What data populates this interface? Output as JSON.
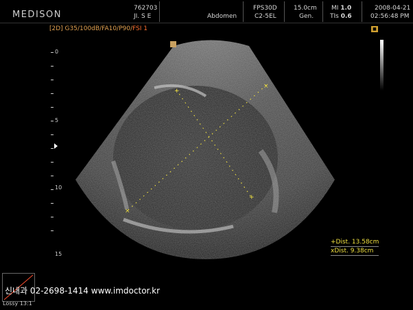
{
  "header": {
    "logo": "MEDISON",
    "patient_id": "762703",
    "patient_name": "JI. S E",
    "preset": "Abdomen",
    "fps": "FPS30D",
    "probe": "C2-5EL",
    "depth": "15.0cm",
    "mode": "Gen.",
    "mi_label": "MI",
    "mi_value": "1.0",
    "tis_label": "TIs",
    "tis_value": "0.6",
    "date": "2008-04-21",
    "time": "02:56:48 PM"
  },
  "mode_line": {
    "params": "[2D] G35/100dB/FA10/P90/",
    "fsi": "FSI 1"
  },
  "depth_scale": {
    "labels": [
      "0",
      "5",
      "10",
      "15"
    ]
  },
  "measurements": {
    "dist1": "+Dist. 13.58cm",
    "dist2": "xDist.  9.38cm"
  },
  "watermark": "신내과 02-2698-1414  www.imdoctor.kr",
  "lossy": "Lossy 13:1",
  "colors": {
    "measure": "#f0e040",
    "mode": "#e0a050",
    "fsi": "#ff7030"
  }
}
